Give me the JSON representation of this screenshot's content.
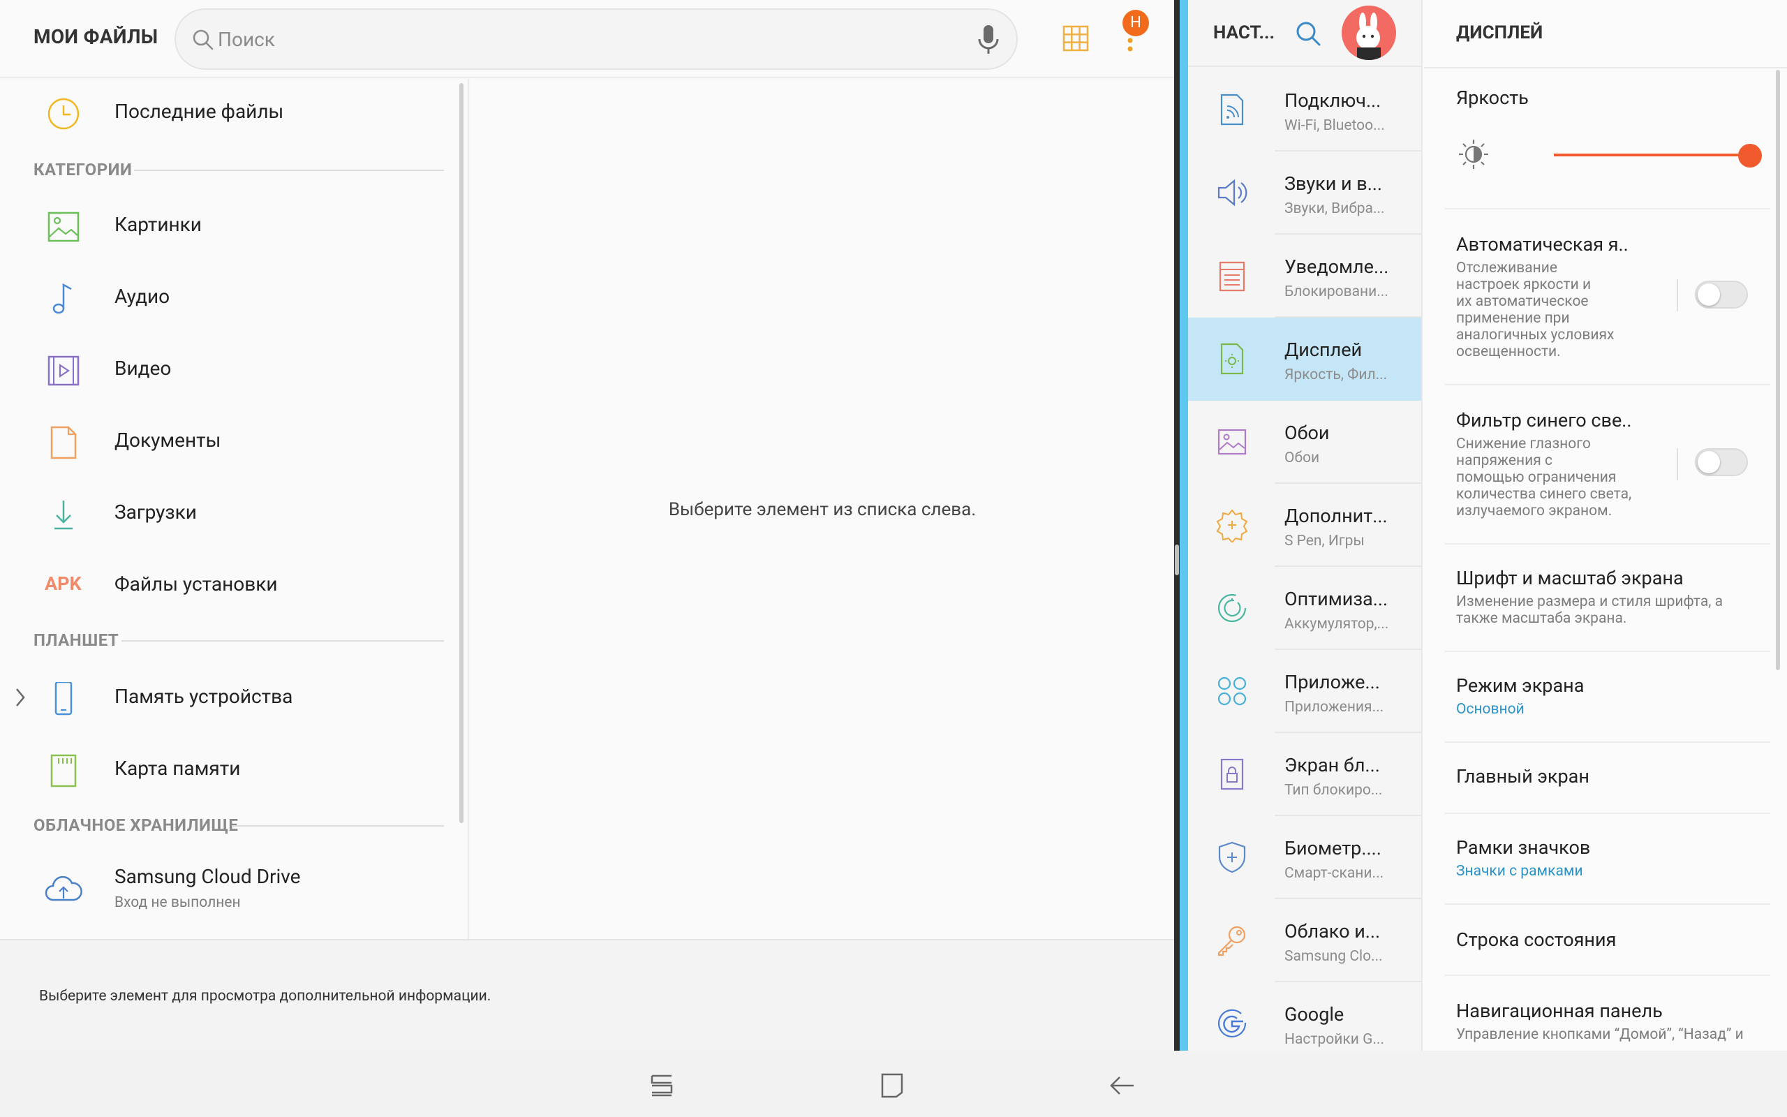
{
  "files": {
    "title": "МОИ ФАЙЛЫ",
    "search_placeholder": "Поиск",
    "avatar_letter": "Н",
    "recent": "Последние файлы",
    "section_categories": "КАТЕГОРИИ",
    "categories": [
      {
        "label": "Картинки",
        "icon": "image-icon"
      },
      {
        "label": "Аудио",
        "icon": "music-note-icon"
      },
      {
        "label": "Видео",
        "icon": "video-icon"
      },
      {
        "label": "Документы",
        "icon": "document-icon"
      },
      {
        "label": "Загрузки",
        "icon": "download-icon"
      },
      {
        "label": "Файлы установки",
        "icon": "apk-icon",
        "icon_text": "APK"
      }
    ],
    "section_tablet": "ПЛАНШЕТ",
    "storage": [
      {
        "label": "Память устройства",
        "icon": "tablet-icon"
      },
      {
        "label": "Карта памяти",
        "icon": "sd-card-icon"
      }
    ],
    "section_cloud": "ОБЛАЧНОЕ ХРАНИЛИЩЕ",
    "cloud": {
      "label": "Samsung Cloud Drive",
      "sub": "Вход не выполнен"
    },
    "detail_message": "Выберите элемент из списка слева.",
    "info_message": "Выберите элемент для просмотра дополнительной информации."
  },
  "settings": {
    "title": "НАСТ...",
    "menu": [
      {
        "title": "Подключ...",
        "sub": "Wi-Fi, Bluetoo...",
        "icon": "connections-icon",
        "color": "#4a90c8"
      },
      {
        "title": "Звуки и в...",
        "sub": "Звуки, Вибра...",
        "icon": "speaker-icon",
        "color": "#5b7bc8"
      },
      {
        "title": "Уведомле...",
        "sub": "Блокировани...",
        "icon": "notifications-icon",
        "color": "#e87a6a"
      },
      {
        "title": "Дисплей",
        "sub": "Яркость, Фил...",
        "icon": "display-icon",
        "color": "#7ab84a",
        "active": true
      },
      {
        "title": "Обои",
        "sub": "Обои",
        "icon": "wallpaper-icon",
        "color": "#b07ac8"
      },
      {
        "title": "Дополнит...",
        "sub": "S Pen, Игры",
        "icon": "advanced-gear-icon",
        "color": "#f0a840"
      },
      {
        "title": "Оптимиза...",
        "sub": "Аккумулятор,...",
        "icon": "optimize-icon",
        "color": "#4ab8a0"
      },
      {
        "title": "Приложе...",
        "sub": "Приложения...",
        "icon": "apps-icon",
        "color": "#4ab0d8"
      },
      {
        "title": "Экран бл...",
        "sub": "Тип блокиро...",
        "icon": "lock-screen-icon",
        "color": "#8a78c8"
      },
      {
        "title": "Биометр....",
        "sub": "Смарт-скани...",
        "icon": "shield-icon",
        "color": "#5a8ac8"
      },
      {
        "title": "Облако и...",
        "sub": "Samsung Clo...",
        "icon": "key-icon",
        "color": "#f0a060"
      },
      {
        "title": "Google",
        "sub": "Настройки G...",
        "icon": "google-icon",
        "color": "#4a7ad8"
      }
    ],
    "detail": {
      "title": "ДИСПЛЕЙ",
      "brightness_label": "Яркость",
      "brightness_level": 0.97,
      "auto_brightness": {
        "title": "Автоматическая я..",
        "desc": [
          "Отслеживание",
          "настроек яркости и",
          "их автоматическое",
          "применение при",
          "аналогичных условиях",
          "освещенности."
        ],
        "enabled": false
      },
      "blue_filter": {
        "title": "Фильтр синего све..",
        "desc": [
          "Снижение глазного",
          "напряжения с",
          "помощью ограничения",
          "количества синего света,",
          "излучаемого экраном."
        ],
        "enabled": false
      },
      "font": {
        "title": "Шрифт и масштаб экрана",
        "desc": [
          "Изменение размера и стиля шрифта, а",
          "также масштаба экрана."
        ]
      },
      "screen_mode": {
        "title": "Режим экрана",
        "value": "Основной"
      },
      "home_screen": {
        "title": "Главный экран"
      },
      "icon_frames": {
        "title": "Рамки значков",
        "value": "Значки с рамками"
      },
      "status_bar": {
        "title": "Строка состояния"
      },
      "nav_bar": {
        "title": "Навигационная панель",
        "desc": "Управление кнопками “Домой”, “Назад” и"
      }
    }
  },
  "colors": {
    "accent": "#f05a2c",
    "active_bg": "#c5e6f6",
    "divider_blue": "#5bc8f0",
    "link_blue": "#2c93c9"
  }
}
